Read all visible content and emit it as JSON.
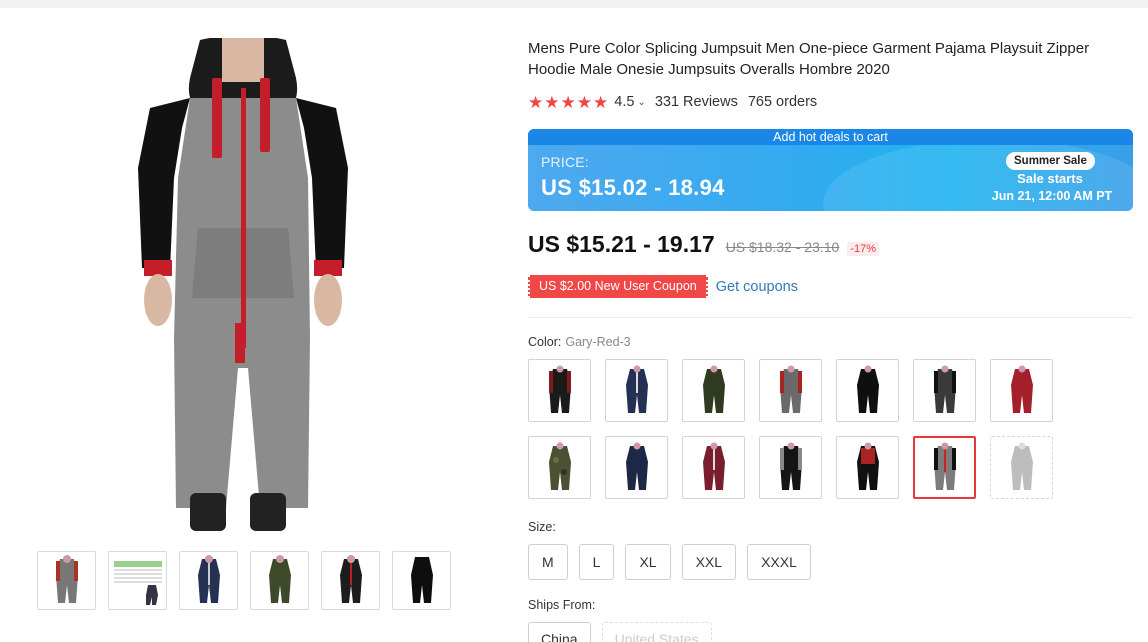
{
  "product": {
    "title": "Mens Pure Color Splicing Jumpsuit Men One-piece Garment Pajama Playsuit Zipper Hoodie Male Onesie Jumpsuits Overalls Hombre 2020",
    "rating": "4.5",
    "rating_stars": 5,
    "reviews": "331 Reviews",
    "orders": "765 orders"
  },
  "deal": {
    "header": "Add hot deals to cart",
    "price_label": "PRICE:",
    "price": "US $15.02 - 18.94",
    "badge": "Summer Sale",
    "sale_line1": "Sale starts",
    "sale_line2": "Jun 21, 12:00 AM PT"
  },
  "pricing": {
    "current": "US $15.21 - 19.17",
    "original": "US $18.32 - 23.10",
    "discount": "-17%"
  },
  "coupon": {
    "tag": "US $2.00 New User Coupon",
    "link": "Get coupons"
  },
  "color": {
    "label": "Color:",
    "selected": "Gary-Red-3"
  },
  "size": {
    "label": "Size:",
    "options": [
      "M",
      "L",
      "XL",
      "XXL",
      "XXXL"
    ]
  },
  "ships": {
    "label": "Ships From:",
    "options": [
      "China",
      "United States"
    ]
  },
  "colors": {
    "red_accent": "#f04743",
    "brand_blue": "#1a86e8",
    "link_blue": "#3478b8"
  }
}
